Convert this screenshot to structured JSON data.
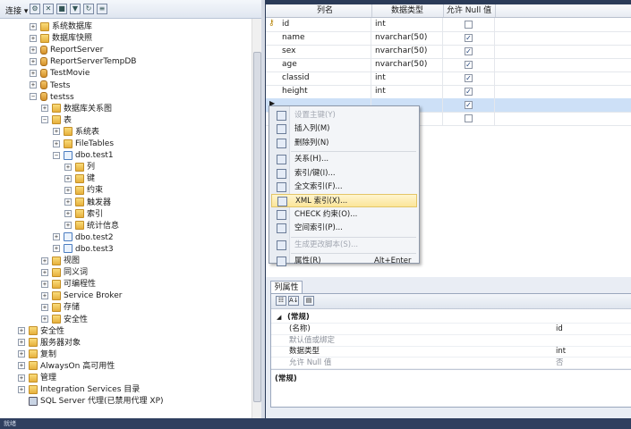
{
  "left_toolbar": {
    "connect_label": "连接 ▾"
  },
  "tree": [
    {
      "label": "系统数据库",
      "indent": 0,
      "exp": "+",
      "icon": "folder"
    },
    {
      "label": "数据库快照",
      "indent": 0,
      "exp": "+",
      "icon": "folder"
    },
    {
      "label": "ReportServer",
      "indent": 0,
      "exp": "+",
      "icon": "db"
    },
    {
      "label": "ReportServerTempDB",
      "indent": 0,
      "exp": "+",
      "icon": "db"
    },
    {
      "label": "TestMovie",
      "indent": 0,
      "exp": "+",
      "icon": "db"
    },
    {
      "label": "Tests",
      "indent": 0,
      "exp": "+",
      "icon": "db"
    },
    {
      "label": "testss",
      "indent": 0,
      "exp": "−",
      "icon": "db"
    },
    {
      "label": "数据库关系图",
      "indent": 1,
      "exp": "+",
      "icon": "folder"
    },
    {
      "label": "表",
      "indent": 1,
      "exp": "−",
      "icon": "folder"
    },
    {
      "label": "系统表",
      "indent": 2,
      "exp": "+",
      "icon": "folder"
    },
    {
      "label": "FileTables",
      "indent": 2,
      "exp": "+",
      "icon": "folder"
    },
    {
      "label": "dbo.test1",
      "indent": 2,
      "exp": "−",
      "icon": "table"
    },
    {
      "label": "列",
      "indent": 3,
      "exp": "+",
      "icon": "folder"
    },
    {
      "label": "键",
      "indent": 3,
      "exp": "+",
      "icon": "folder"
    },
    {
      "label": "约束",
      "indent": 3,
      "exp": "+",
      "icon": "folder"
    },
    {
      "label": "触发器",
      "indent": 3,
      "exp": "+",
      "icon": "folder"
    },
    {
      "label": "索引",
      "indent": 3,
      "exp": "+",
      "icon": "folder"
    },
    {
      "label": "统计信息",
      "indent": 3,
      "exp": "+",
      "icon": "folder"
    },
    {
      "label": "dbo.test2",
      "indent": 2,
      "exp": "+",
      "icon": "table"
    },
    {
      "label": "dbo.test3",
      "indent": 2,
      "exp": "+",
      "icon": "table"
    },
    {
      "label": "视图",
      "indent": 1,
      "exp": "+",
      "icon": "folder"
    },
    {
      "label": "同义词",
      "indent": 1,
      "exp": "+",
      "icon": "folder"
    },
    {
      "label": "可编程性",
      "indent": 1,
      "exp": "+",
      "icon": "folder"
    },
    {
      "label": "Service Broker",
      "indent": 1,
      "exp": "+",
      "icon": "folder"
    },
    {
      "label": "存储",
      "indent": 1,
      "exp": "+",
      "icon": "folder"
    },
    {
      "label": "安全性",
      "indent": 1,
      "exp": "+",
      "icon": "folder"
    },
    {
      "label": "安全性",
      "indent": -1,
      "exp": "+",
      "icon": "folder"
    },
    {
      "label": "服务器对象",
      "indent": -1,
      "exp": "+",
      "icon": "folder"
    },
    {
      "label": "复制",
      "indent": -1,
      "exp": "+",
      "icon": "folder"
    },
    {
      "label": "AlwaysOn 高可用性",
      "indent": -1,
      "exp": "+",
      "icon": "folder"
    },
    {
      "label": "管理",
      "indent": -1,
      "exp": "+",
      "icon": "folder"
    },
    {
      "label": "Integration Services 目录",
      "indent": -1,
      "exp": "+",
      "icon": "folder"
    },
    {
      "label": "SQL Server 代理(已禁用代理 XP)",
      "indent": -1,
      "exp": "",
      "icon": "agent"
    }
  ],
  "grid": {
    "headers": [
      "列名",
      "数据类型",
      "允许 Null 值"
    ],
    "rows": [
      {
        "name": "id",
        "type": "int",
        "null": false,
        "key": true
      },
      {
        "name": "name",
        "type": "nvarchar(50)",
        "null": true
      },
      {
        "name": "sex",
        "type": "nvarchar(50)",
        "null": true
      },
      {
        "name": "age",
        "type": "nvarchar(50)",
        "null": true
      },
      {
        "name": "classid",
        "type": "int",
        "null": true
      },
      {
        "name": "height",
        "type": "int",
        "null": true
      },
      {
        "name": "",
        "type": "",
        "null": true,
        "selected": true
      },
      {
        "name": "",
        "type": "",
        "null": false
      }
    ]
  },
  "menu": [
    {
      "label": "设置主键(Y)",
      "disabled": true,
      "icon": "key-icon"
    },
    {
      "label": "插入列(M)",
      "icon": "insert-column-icon"
    },
    {
      "label": "删除列(N)",
      "icon": "delete-column-icon"
    },
    {
      "sep": true
    },
    {
      "label": "关系(H)...",
      "icon": "relationship-icon"
    },
    {
      "label": "索引/键(I)...",
      "icon": "index-icon"
    },
    {
      "label": "全文索引(F)...",
      "icon": "fulltext-index-icon"
    },
    {
      "label": "XML 索引(X)...",
      "highlight": true,
      "icon": "xml-index-icon"
    },
    {
      "label": "CHECK 约束(O)...",
      "icon": "check-constraint-icon"
    },
    {
      "label": "空间索引(P)...",
      "icon": "spatial-index-icon"
    },
    {
      "sep": true
    },
    {
      "label": "生成更改脚本(S)...",
      "disabled": true,
      "icon": "script-icon"
    },
    {
      "sep": true
    },
    {
      "label": "属性(R)",
      "shortcut": "Alt+Enter",
      "icon": "properties-icon"
    }
  ],
  "props": {
    "tab_label": "列属性",
    "group": "(常规)",
    "rows": [
      {
        "name": "(名称)",
        "value": "id"
      },
      {
        "name": "默认值或绑定",
        "value": "",
        "dim": true
      },
      {
        "name": "数据类型",
        "value": "int"
      },
      {
        "name": "允许 Null 值",
        "value": "否",
        "dim": true
      }
    ],
    "desc_title": "(常规)"
  },
  "status": {
    "text": "就绪"
  }
}
